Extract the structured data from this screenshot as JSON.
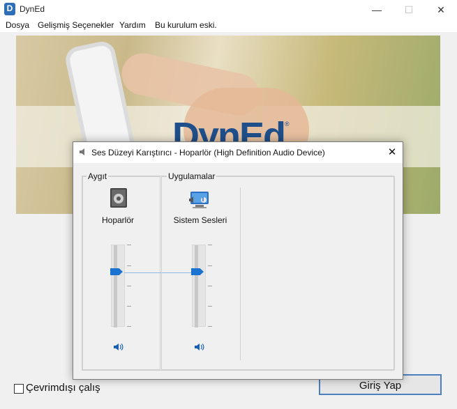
{
  "window": {
    "title": "DynEd",
    "app_icon_letter": "D",
    "minimize": "—",
    "maximize": "☐",
    "close": "✕"
  },
  "menu": [
    "Dosya",
    "Gelişmiş Seçenekler",
    "Yardım",
    "Bu kurulum eski."
  ],
  "banner": {
    "brand": "DynEd",
    "brand_mark": "®"
  },
  "offline_label": "Çevrimdışı çalış",
  "login_button": "Giriş Yap",
  "mixer": {
    "title": "Ses Düzeyi Karıştırıcı - Hoparlör (High Definition Audio Device)",
    "close": "✕",
    "device_group": "Aygıt",
    "apps_group": "Uygulamalar",
    "device_name": "Hoparlör",
    "app_name": "Sistem Sesleri",
    "device_level": 0.67,
    "app_level": 0.67,
    "device_icon": "speaker-device-icon",
    "app_icon": "system-sounds-icon",
    "mute_icon": "speaker-volume-icon",
    "accent_color": "#1a73d0"
  }
}
